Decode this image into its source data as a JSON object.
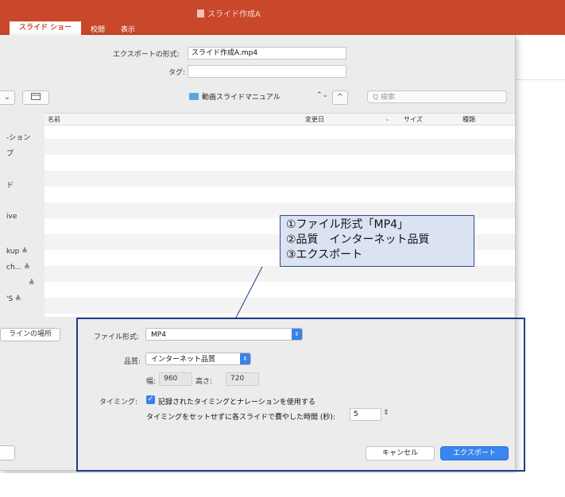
{
  "app": {
    "document_title": "スライド作成A",
    "ribbon_tabs": [
      {
        "label": "スライド ショー",
        "active": true
      },
      {
        "label": "校閲",
        "active": false
      },
      {
        "label": "表示",
        "active": false
      }
    ],
    "accent_color": "#c9472a"
  },
  "dialog": {
    "export_as_label": "エクスポートの形式:",
    "export_as_value": "スライド作成A.mp4",
    "tags_label": "タグ:",
    "tags_value": "",
    "toolbar": {
      "view_button": "⌄",
      "newfolder_icon": "folder-icon",
      "location": "動画スライドマニュアル",
      "location_updown": "⌃⌄",
      "collapse_button": "^",
      "search_placeholder": "Q 検索"
    },
    "sidebar_items": [
      {
        "label": "-ション"
      },
      {
        "label": "プ"
      },
      {
        "label": "ド"
      },
      {
        "label": "ive"
      },
      {
        "label": "kup  ≜"
      },
      {
        "label": "ch...  ≜"
      },
      {
        "label": "≜"
      },
      {
        "label": "'S  ≜"
      }
    ],
    "columns": [
      "名前",
      "変更日",
      "⌄",
      "サイズ",
      "種類"
    ],
    "online_locations_button": "ラインの場所",
    "options": {
      "file_format_label": "ファイル形式:",
      "file_format_value": "MP4",
      "quality_label": "品質:",
      "quality_value": "インターネット品質",
      "width_label": "幅:",
      "width_value": "960",
      "height_label": "高さ:",
      "height_value": "720",
      "timing_label": "タイミング:",
      "timing_checkbox_label": "記録されたタイミングとナレーションを使用する",
      "timing_checked": true,
      "seconds_label": "タイミングをセットせずに各スライドで費やした時間 (秒):",
      "seconds_value": "5"
    },
    "cancel_label": "キャンセル",
    "export_label": "エクスポート"
  },
  "annotation": {
    "lines": [
      "①ファイル形式「MP4」",
      "②品質　インターネット品質",
      "③エクスポート"
    ]
  }
}
